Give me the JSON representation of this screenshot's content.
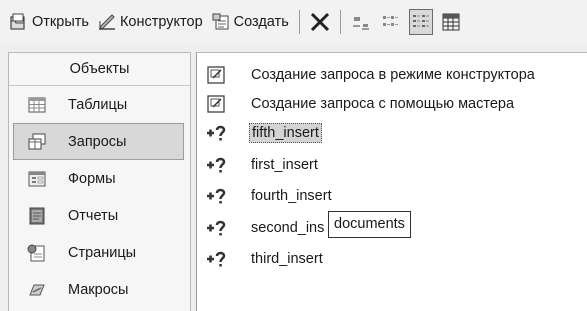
{
  "toolbar": {
    "open_label": "Открыть",
    "designer_label": "Конструктор",
    "create_label": "Создать"
  },
  "objects_panel": {
    "header": "Объекты",
    "items": [
      {
        "label": "Таблицы",
        "icon": "table-icon"
      },
      {
        "label": "Запросы",
        "icon": "query-icon",
        "selected": true
      },
      {
        "label": "Формы",
        "icon": "form-icon"
      },
      {
        "label": "Отчеты",
        "icon": "report-icon"
      },
      {
        "label": "Страницы",
        "icon": "page-icon"
      },
      {
        "label": "Макросы",
        "icon": "macro-icon"
      }
    ]
  },
  "query_list": {
    "items": [
      {
        "label": "Создание запроса в режиме конструктора",
        "icon": "wizard-icon"
      },
      {
        "label": "Создание запроса с помощью мастера",
        "icon": "wizard-icon"
      },
      {
        "label": "fifth_insert",
        "icon": "append-query-icon",
        "selected": true
      },
      {
        "label": "first_insert",
        "icon": "append-query-icon"
      },
      {
        "label": "fourth_insert",
        "icon": "append-query-icon"
      },
      {
        "label": "second_ins",
        "icon": "append-query-icon"
      },
      {
        "label": "third_insert",
        "icon": "append-query-icon"
      }
    ]
  },
  "tooltip": {
    "text": "documents"
  }
}
